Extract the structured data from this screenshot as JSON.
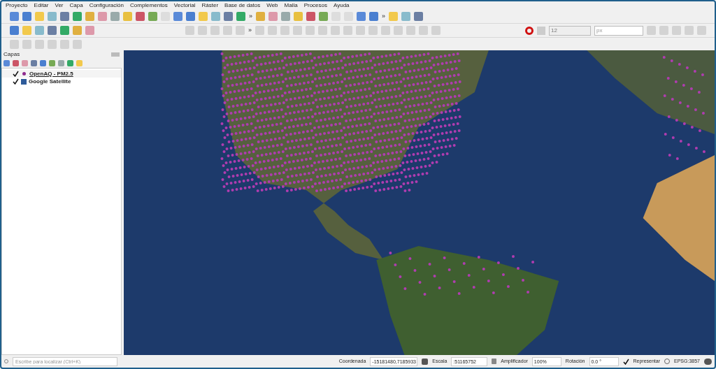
{
  "menu": [
    "Proyecto",
    "Editar",
    "Ver",
    "Capa",
    "Configuración",
    "Complementos",
    "Vectorial",
    "Ráster",
    "Base de datos",
    "Web",
    "Malla",
    "Procesos",
    "Ayuda"
  ],
  "toolbar_overflow": [
    "»",
    "»",
    "»"
  ],
  "snapping": {
    "tolerance": "12",
    "unit": "px"
  },
  "layers_panel": {
    "title": "Capas",
    "layers": [
      {
        "name": "OpenAQ - PM2.5",
        "checked": true,
        "selected": true,
        "kind": "points"
      },
      {
        "name": "Google Satellite",
        "checked": true,
        "selected": false,
        "kind": "raster"
      }
    ]
  },
  "status_bar": {
    "search": {
      "placeholder": "Escribe para localizar (Ctrl+K)"
    },
    "coordinate_label": "Coordenada",
    "coordinate": "-15181480,7185933",
    "scale_label": "Escala",
    "scale": ":51165752",
    "magnifier_label": "Amplificador",
    "magnifier": "100%",
    "rotation_label": "Rotación",
    "rotation": "0.0 °",
    "render": {
      "label": "Representar",
      "checked": true
    },
    "crs": "EPSG:3857"
  }
}
